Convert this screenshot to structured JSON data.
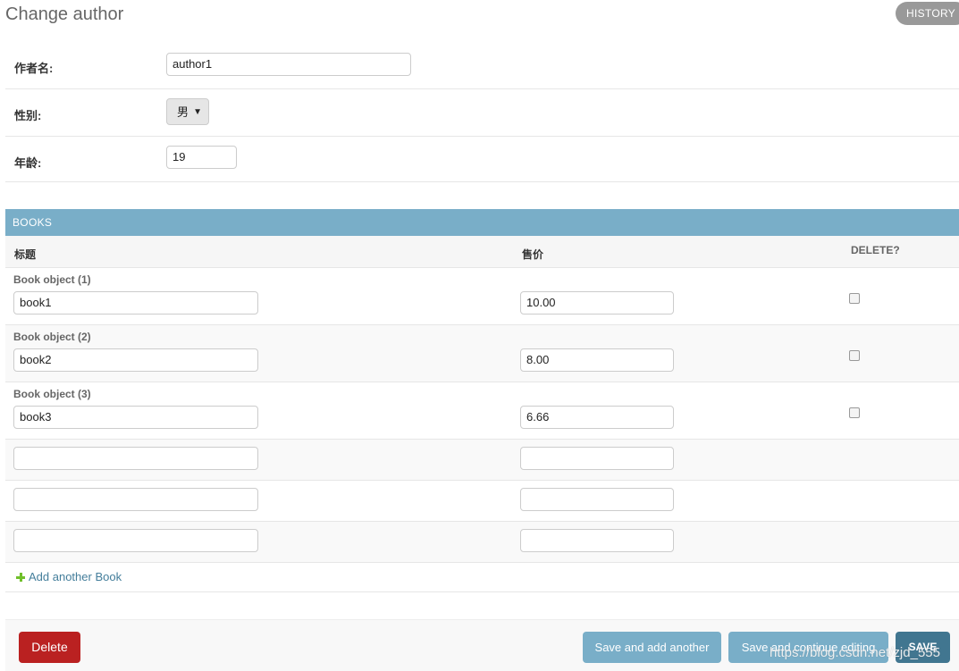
{
  "page": {
    "title": "Change author",
    "history_label": "HISTORY"
  },
  "fields": {
    "name": {
      "label": "作者名:",
      "value": "author1"
    },
    "gender": {
      "label": "性别:",
      "value": "男"
    },
    "age": {
      "label": "年龄:",
      "value": "19"
    }
  },
  "books": {
    "caption": "BOOKS",
    "headers": {
      "title": "标题",
      "price": "售价",
      "delete": "DELETE?"
    },
    "rows": [
      {
        "label": "Book object (1)",
        "title": "book1",
        "price": "10.00"
      },
      {
        "label": "Book object (2)",
        "title": "book2",
        "price": "8.00"
      },
      {
        "label": "Book object (3)",
        "title": "book3",
        "price": "6.66"
      },
      {
        "label": "",
        "title": "",
        "price": ""
      },
      {
        "label": "",
        "title": "",
        "price": ""
      },
      {
        "label": "",
        "title": "",
        "price": ""
      }
    ],
    "add_label": "Add another Book"
  },
  "actions": {
    "delete": "Delete",
    "save_add_another": "Save and add another",
    "save_continue": "Save and continue editing",
    "save": "SAVE"
  },
  "watermark": "https://blog.csdn.net/zjd_555",
  "colors": {
    "module_header": "#79aec8",
    "delete_button": "#ba2121",
    "save_button": "#417690",
    "link": "#447e9b",
    "add_icon": "#70bf2b"
  }
}
